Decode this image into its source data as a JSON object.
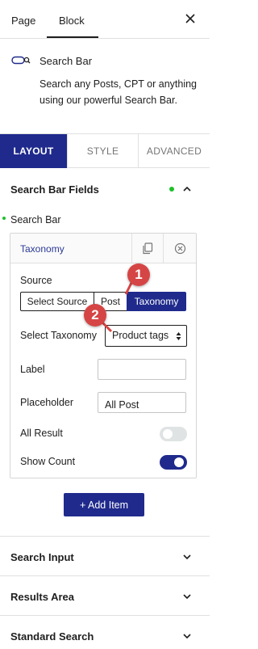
{
  "top_tabs": {
    "page": "Page",
    "block": "Block",
    "active": "Block"
  },
  "block": {
    "title": "Search Bar",
    "description": "Search any Posts, CPT or anything using our powerful Search Bar."
  },
  "mode_tabs": {
    "layout": "LAYOUT",
    "style": "STYLE",
    "advanced": "ADVANCED",
    "active": "LAYOUT"
  },
  "panels": {
    "search_bar_fields": "Search Bar Fields",
    "search_input": "Search Input",
    "results_area": "Results Area",
    "standard_search": "Standard Search"
  },
  "fields_group": {
    "label": "Search Bar",
    "item": {
      "name": "Taxonomy",
      "source_label": "Source",
      "source_options": [
        "Select Source",
        "Post",
        "Taxonomy"
      ],
      "source_selected": "Taxonomy",
      "taxonomy_label": "Select Taxonomy",
      "taxonomy_value": "Product tags",
      "label_label": "Label",
      "label_value": "",
      "placeholder_label": "Placeholder",
      "placeholder_value": "All Post",
      "all_result_label": "All Result",
      "all_result_on": false,
      "show_count_label": "Show Count",
      "show_count_on": true
    },
    "add_item": "+ Add Item"
  },
  "annotations": {
    "badge1": "1",
    "badge2": "2"
  },
  "colors": {
    "accent": "#1f2a8c",
    "status_dot": "#1dc02a",
    "badge": "#d64545"
  },
  "icons": {
    "close": "close-icon",
    "block": "search-bar-block-icon",
    "chevron_up": "chevron-up-icon",
    "chevron_down": "chevron-down-icon",
    "copy": "copy-icon",
    "remove": "remove-circle-icon",
    "select_arrows": "up-down-arrows-icon"
  }
}
